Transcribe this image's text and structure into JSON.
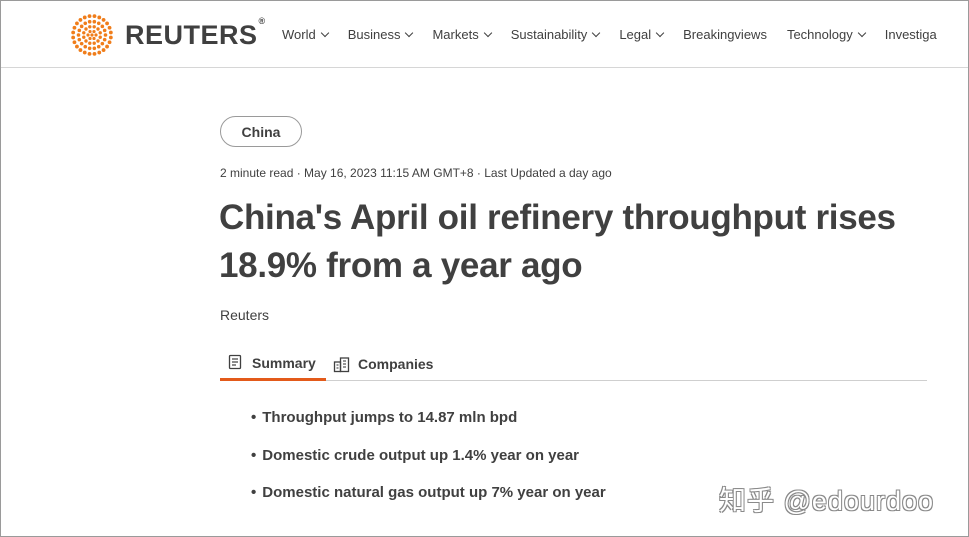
{
  "header": {
    "brand": "REUTERS",
    "brand_mark": "®",
    "nav": [
      {
        "label": "World",
        "dropdown": true
      },
      {
        "label": "Business",
        "dropdown": true
      },
      {
        "label": "Markets",
        "dropdown": true
      },
      {
        "label": "Sustainability",
        "dropdown": true
      },
      {
        "label": "Legal",
        "dropdown": true
      },
      {
        "label": "Breakingviews",
        "dropdown": false
      },
      {
        "label": "Technology",
        "dropdown": true
      },
      {
        "label": "Investiga",
        "dropdown": false
      }
    ]
  },
  "article": {
    "tag": "China",
    "meta": "2 minute read · May 16, 2023 11:15 AM GMT+8 · Last Updated a day ago",
    "headline": "China's April oil refinery throughput rises 18.9% from a year ago",
    "byline": "Reuters",
    "tabs": [
      {
        "label": "Summary",
        "icon": "summary-icon",
        "active": true
      },
      {
        "label": "Companies",
        "icon": "companies-icon",
        "active": false
      }
    ],
    "summary": [
      "Throughput jumps to 14.87 mln bpd",
      "Domestic crude output up 1.4% year on year",
      "Domestic natural gas output up 7% year on year"
    ]
  },
  "watermark": "知乎 @edourdoo",
  "colors": {
    "accent": "#e35a1a",
    "logo_orange": "#f07d1a",
    "text": "#404040"
  }
}
